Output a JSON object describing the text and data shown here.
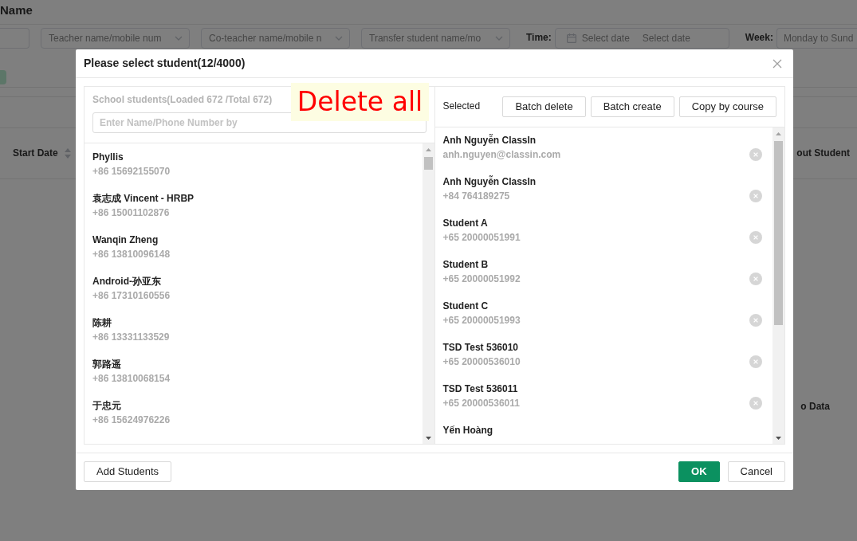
{
  "background_page": {
    "title": "Name",
    "filters": [
      {
        "kind": "text"
      },
      {
        "kind": "select",
        "placeholder": "Teacher name/mobile num"
      },
      {
        "kind": "select",
        "placeholder": "Co-teacher name/mobile n"
      },
      {
        "kind": "select",
        "placeholder": "Transfer student name/mo"
      },
      {
        "kind": "date_range",
        "label": "Time:",
        "start_placeholder": "Select date",
        "end_placeholder": "Select date"
      },
      {
        "kind": "text",
        "label": "Week:",
        "placeholder": "Monday to Sund"
      }
    ],
    "table": {
      "columns": [
        {
          "label": "Start Date",
          "sortable": true
        },
        {
          "label": "out Student",
          "sortable": false
        }
      ],
      "empty_text": "o Data"
    }
  },
  "dialog": {
    "title": "Please select student(12/4000)",
    "annotation": {
      "text": "Delete all"
    },
    "source_panel": {
      "heading": "School students(Loaded 672 /Total 672)",
      "search": {
        "placeholder": "Enter Name/Phone Number by"
      },
      "students": [
        {
          "name": "Phyllis",
          "phone": "+86 15692155070"
        },
        {
          "name": "袁志成 Vincent - HRBP",
          "phone": "+86 15001102876"
        },
        {
          "name": "Wanqin Zheng",
          "phone": "+86 13810096148"
        },
        {
          "name": "Android-孙亚东",
          "phone": "+86 17310160556"
        },
        {
          "name": "陈耕",
          "phone": "+86 13331133529"
        },
        {
          "name": "郭路遥",
          "phone": "+86 13810068154"
        },
        {
          "name": "于忠元",
          "phone": "+86 15624976226"
        }
      ]
    },
    "selected_panel": {
      "heading": "Selected",
      "buttons": [
        "Batch delete",
        "Batch create",
        "Copy by course"
      ],
      "students": [
        {
          "name": "Anh Nguyễn ClassIn",
          "detail": "anh.nguyen@classin.com"
        },
        {
          "name": "Anh Nguyễn ClassIn",
          "detail": "+84 764189275"
        },
        {
          "name": "Student A",
          "detail": "+65 20000051991"
        },
        {
          "name": "Student B",
          "detail": "+65 20000051992"
        },
        {
          "name": "Student C",
          "detail": "+65 20000051993"
        },
        {
          "name": "TSD Test 536010",
          "detail": "+65 20000536010"
        },
        {
          "name": "TSD Test 536011",
          "detail": "+65 20000536011"
        },
        {
          "name": "Yến Hoàng"
        }
      ]
    },
    "footer": {
      "left_buttons": [
        "Add Students"
      ],
      "right_buttons": [
        {
          "label": "OK",
          "kind": "primary"
        },
        {
          "label": "Cancel",
          "kind": "default"
        }
      ]
    }
  }
}
